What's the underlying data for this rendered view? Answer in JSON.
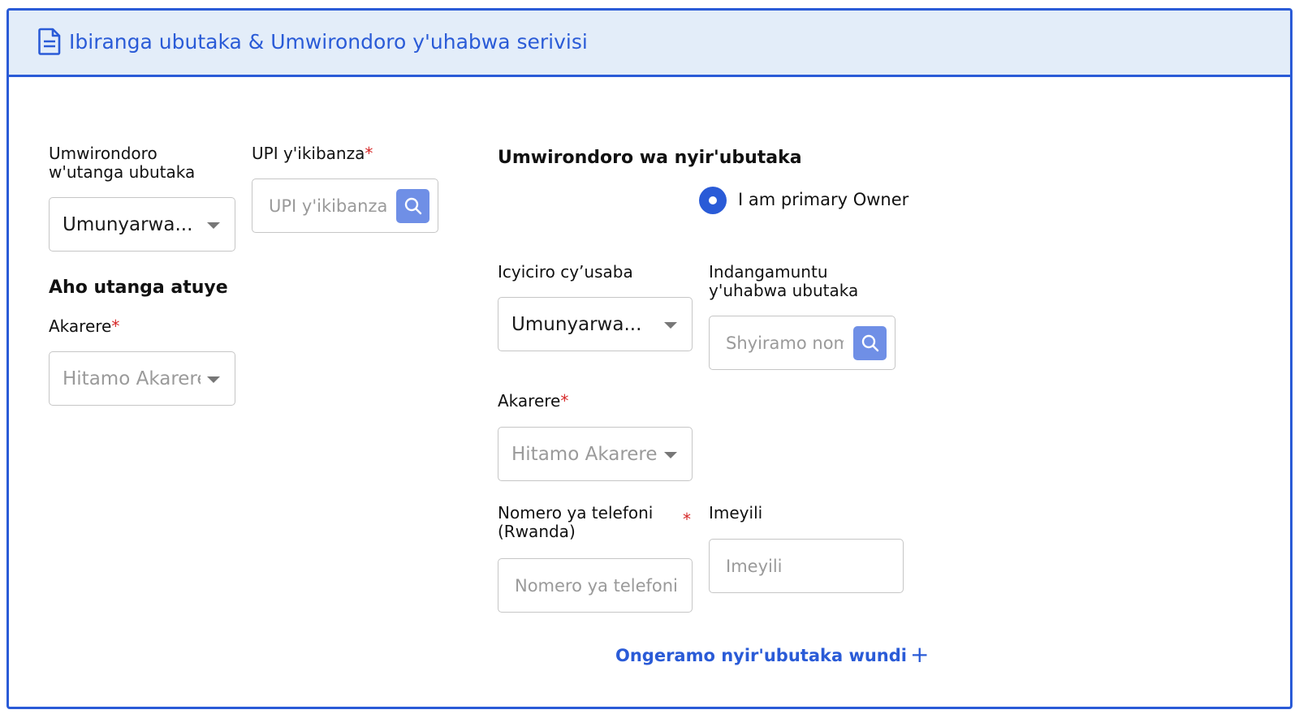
{
  "header": {
    "title": "Ibiranga ubutaka & Umwirondoro y'uhabwa serivisi",
    "icon": "document-icon"
  },
  "left": {
    "provider_id_label": "Umwirondoro\nw'utanga ubutaka",
    "provider_id_value": "Umunyarwa...",
    "upi_label": "UPI y'ikibanza",
    "upi_placeholder": "UPI y'ikibanza",
    "location_heading": "Aho utanga atuye",
    "district_label": "Akarere",
    "district_placeholder": "Hitamo Akarere"
  },
  "owner": {
    "heading": "Umwirondoro wa nyir'ubutaka",
    "primary_owner_label": "I am primary Owner",
    "primary_owner_selected": true,
    "category_label": "Icyiciro cy’usaba",
    "category_value": "Umunyarwa...",
    "national_id_label": "Indangamuntu\ny'uhabwa ubutaka",
    "national_id_placeholder": "Shyiramo nomero",
    "district_label": "Akarere",
    "district_placeholder": "Hitamo Akarere",
    "phone_label": "Nomero ya telefoni\n(Rwanda)",
    "phone_placeholder": "Nomero ya telefoni",
    "email_label": "Imeyili",
    "email_placeholder": "Imeyili",
    "add_owner_label": "Ongeramo nyir'ubutaka wundi",
    "add_owner_icon": "plus-icon"
  },
  "colors": {
    "accent": "#2a5bd7",
    "header_bg": "#e3edf9",
    "required": "#d62828",
    "search_button": "#6f8fe6"
  }
}
